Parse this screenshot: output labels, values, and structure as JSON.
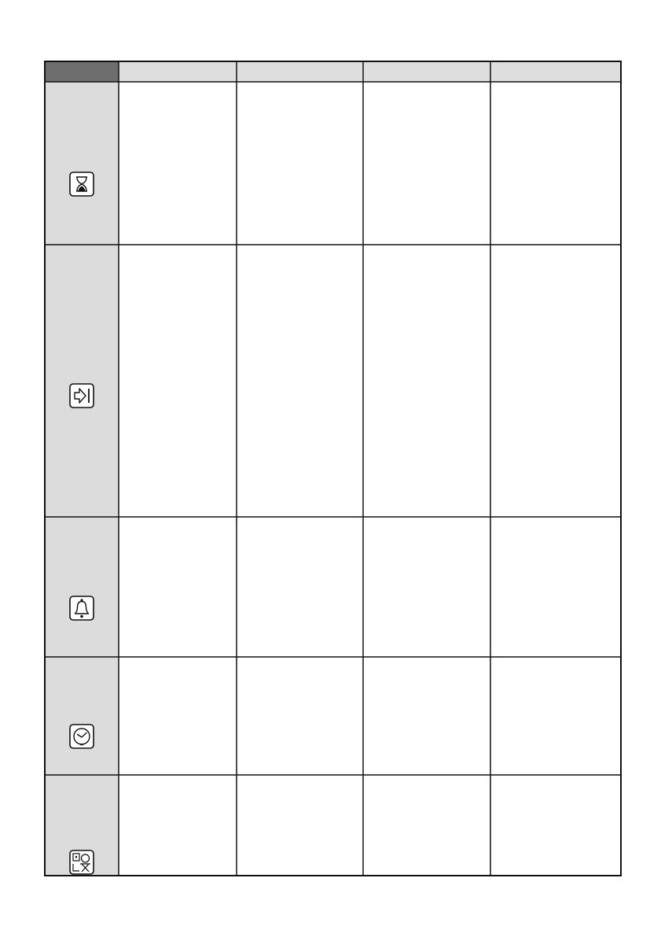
{
  "table": {
    "header_cells": [
      "",
      "",
      "",
      "",
      ""
    ],
    "rows": [
      {
        "icon": "hourglass-icon",
        "cells": [
          "",
          "",
          "",
          ""
        ]
      },
      {
        "icon": "arrow-to-bar-icon",
        "cells": [
          "",
          "",
          "",
          ""
        ]
      },
      {
        "icon": "bell-icon",
        "cells": [
          "",
          "",
          "",
          ""
        ]
      },
      {
        "icon": "clock-icon",
        "cells": [
          "",
          "",
          "",
          ""
        ]
      },
      {
        "icon": "child-lock-icon",
        "cells": [
          "",
          "",
          "",
          ""
        ]
      }
    ]
  },
  "colors": {
    "header_first_cell": "#6e6e6e",
    "header_cell": "#dedede",
    "icon_column": "#dcdcdc",
    "body_cell": "#ffffff",
    "line": "#111111"
  }
}
